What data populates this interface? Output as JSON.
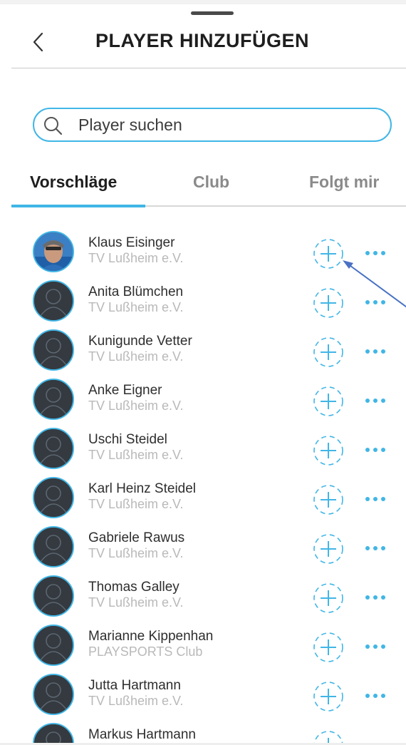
{
  "header": {
    "title": "PLAYER HINZUFÜGEN"
  },
  "search": {
    "placeholder": "Player suchen",
    "value": ""
  },
  "tabs": [
    {
      "label": "Vorschläge",
      "active": true
    },
    {
      "label": "Club",
      "active": false
    },
    {
      "label": "Folgt mir",
      "active": false
    }
  ],
  "players": [
    {
      "name": "Klaus Eisinger",
      "club": "TV Lußheim e.V.",
      "has_photo": true
    },
    {
      "name": "Anita Blümchen",
      "club": "TV Lußheim e.V.",
      "has_photo": false
    },
    {
      "name": "Kunigunde Vetter",
      "club": "TV Lußheim e.V.",
      "has_photo": false
    },
    {
      "name": "Anke Eigner",
      "club": "TV Lußheim e.V.",
      "has_photo": false
    },
    {
      "name": "Uschi Steidel",
      "club": "TV Lußheim e.V.",
      "has_photo": false
    },
    {
      "name": "Karl Heinz Steidel",
      "club": "TV Lußheim e.V.",
      "has_photo": false
    },
    {
      "name": "Gabriele Rawus",
      "club": "TV Lußheim e.V.",
      "has_photo": false
    },
    {
      "name": "Thomas Galley",
      "club": "TV Lußheim e.V.",
      "has_photo": false
    },
    {
      "name": "Marianne Kippenhan",
      "club": "PLAYSPORTS Club",
      "has_photo": false
    },
    {
      "name": "Jutta Hartmann",
      "club": "TV Lußheim e.V.",
      "has_photo": false
    },
    {
      "name": "Markus Hartmann",
      "club": "",
      "has_photo": false
    }
  ],
  "colors": {
    "accent": "#41b6e6",
    "avatar_bg": "#343a40",
    "annotation_arrow": "#4a72c4"
  },
  "icons": {
    "back": "chevron-left-icon",
    "search": "search-icon",
    "add": "plus-dashed-circle-icon",
    "more": "ellipsis-icon",
    "avatar_placeholder": "user-silhouette-icon"
  }
}
